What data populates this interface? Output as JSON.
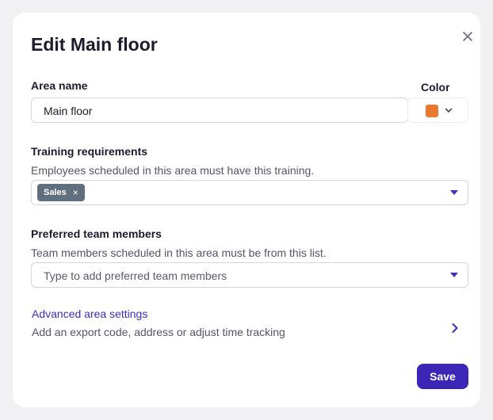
{
  "dialog": {
    "title": "Edit Main floor"
  },
  "area_name": {
    "label": "Area name",
    "value": "Main floor"
  },
  "color": {
    "label": "Color",
    "value": "#e87a30"
  },
  "training": {
    "label": "Training requirements",
    "help": "Employees scheduled in this area must have this training.",
    "tags": [
      "Sales"
    ],
    "tag_remove": "×"
  },
  "preferred": {
    "label": "Preferred team members",
    "help": "Team members scheduled in this area must be from this list.",
    "placeholder": "Type to add preferred team members"
  },
  "advanced": {
    "title": "Advanced area settings",
    "description": "Add an export code, address or adjust time tracking"
  },
  "actions": {
    "save_label": "Save"
  },
  "icons": {
    "close": "close-icon",
    "color_dropdown": "chevron-down-icon",
    "dropdown": "caret-down-icon",
    "advanced": "chevron-right-icon"
  },
  "colors": {
    "accent": "#3b26b8",
    "link": "#3b2cc4",
    "tag_bg": "#5f6f7e"
  }
}
